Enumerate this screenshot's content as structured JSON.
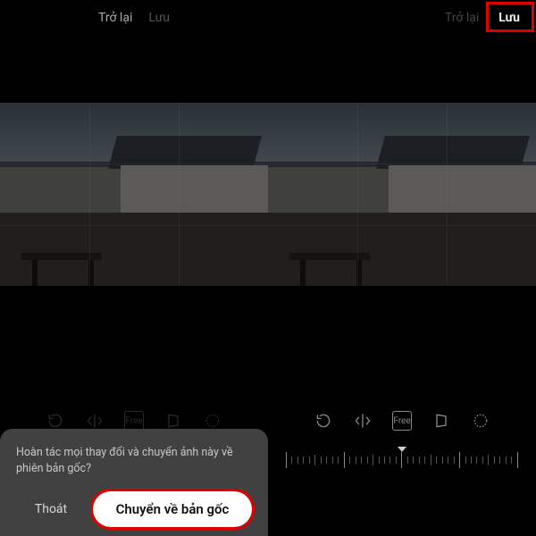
{
  "highlight_color": "#e00000",
  "left": {
    "header": {
      "back": "Trở lại",
      "save": "Lưu"
    },
    "toolbar": {
      "rotate": "rotate-icon",
      "flip": "flip-icon",
      "free": "Free",
      "perspective": "perspective-icon",
      "auto": "auto-icon"
    },
    "dialog": {
      "message": "Hoàn tác mọi thay đổi và chuyển ảnh này về phiên bản gốc?",
      "exit": "Thoát",
      "revert": "Chuyển về bản gốc"
    }
  },
  "right": {
    "header": {
      "back": "Trở lại",
      "save": "Lưu"
    },
    "toolbar": {
      "rotate": "rotate-icon",
      "flip": "flip-icon",
      "free": "Free",
      "perspective": "perspective-icon",
      "auto": "auto-icon"
    }
  }
}
